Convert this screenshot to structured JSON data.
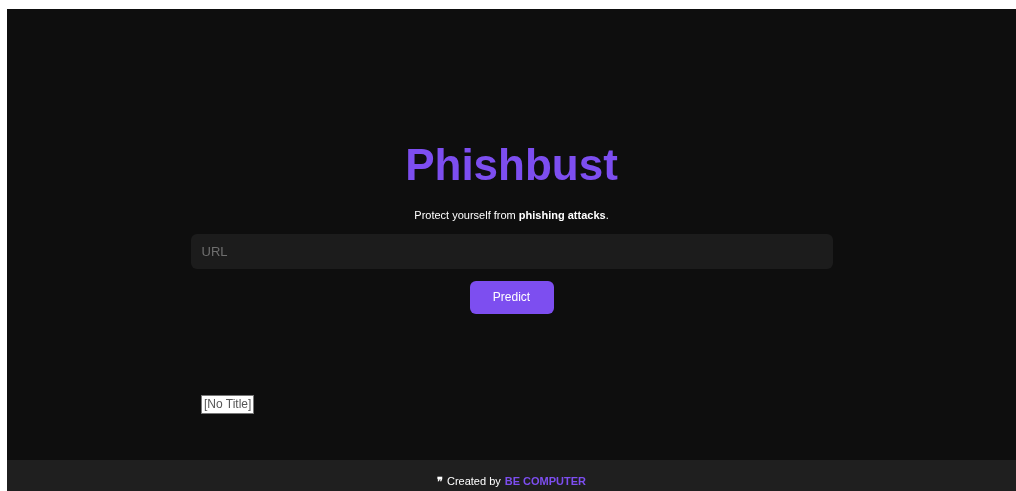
{
  "title": "Phishbust",
  "tagline": "Protect yourself from **phishing attacks**.",
  "url_field": {
    "placeholder": "URL"
  },
  "predict_button": "Predict",
  "tooltip": "[No Title]",
  "footer": {
    "quote_mark": "❞",
    "text": "Created by",
    "author": "BE COMPUTER"
  }
}
